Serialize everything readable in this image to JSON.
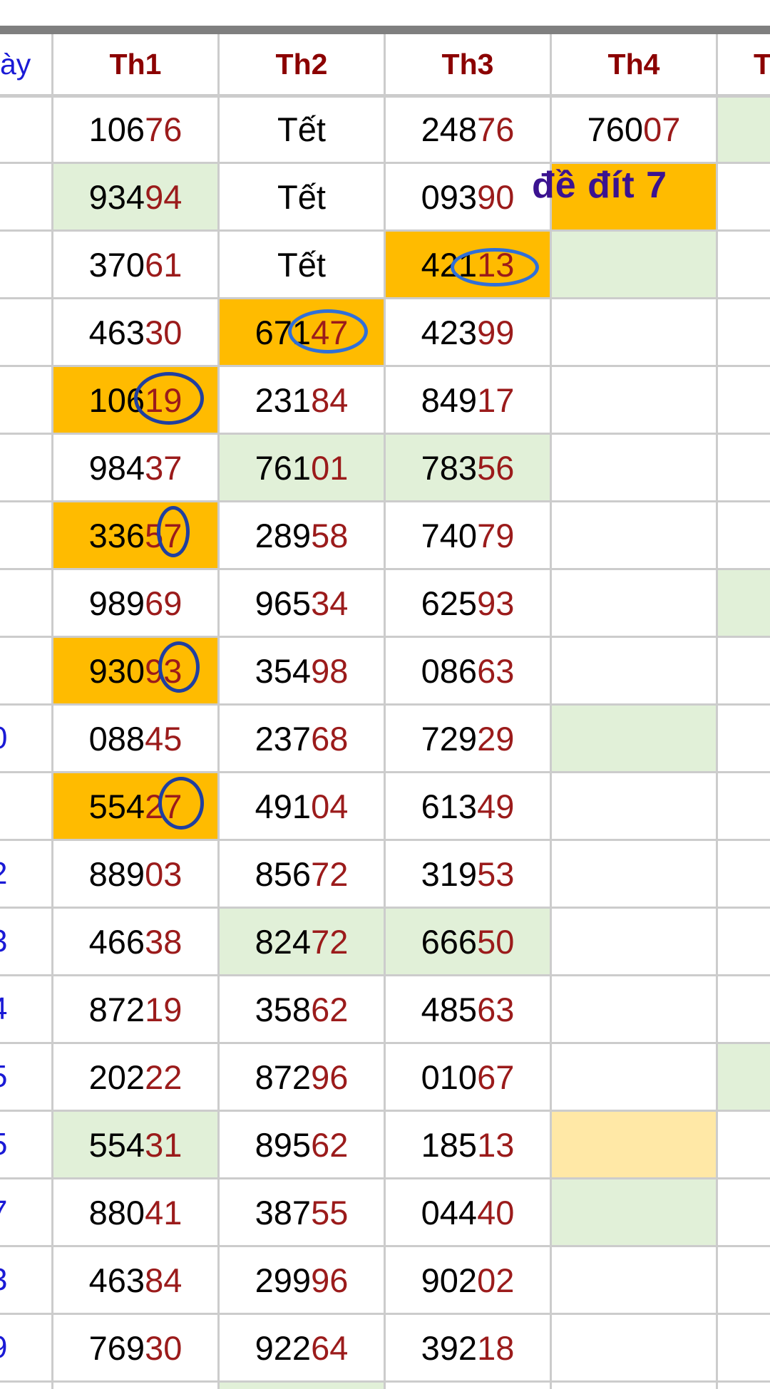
{
  "header": {
    "left_fragment": "ày",
    "columns": [
      "Th1",
      "Th2",
      "Th3",
      "Th4",
      "Th"
    ]
  },
  "row_labels": [
    "",
    "",
    "",
    "",
    "",
    "",
    "",
    "",
    "",
    "0",
    "",
    "2",
    "3",
    "4",
    "5",
    "5",
    "7",
    "3",
    "9"
  ],
  "rows": [
    [
      {
        "head": "106",
        "tail": "76"
      },
      {
        "head": "Tết",
        "tail": ""
      },
      {
        "head": "248",
        "tail": "76"
      },
      {
        "head": "760",
        "tail": "07"
      }
    ],
    [
      {
        "head": "934",
        "tail": "94"
      },
      {
        "head": "Tết",
        "tail": ""
      },
      {
        "head": "093",
        "tail": "90"
      },
      {
        "head": "",
        "tail": ""
      }
    ],
    [
      {
        "head": "370",
        "tail": "61"
      },
      {
        "head": "Tết",
        "tail": ""
      },
      {
        "head": "421",
        "tail": "13"
      },
      {
        "head": "",
        "tail": ""
      }
    ],
    [
      {
        "head": "463",
        "tail": "30"
      },
      {
        "head": "671",
        "tail": "47"
      },
      {
        "head": "423",
        "tail": "99"
      },
      {
        "head": "",
        "tail": ""
      }
    ],
    [
      {
        "head": "106",
        "tail": "19"
      },
      {
        "head": "231",
        "tail": "84"
      },
      {
        "head": "849",
        "tail": "17"
      },
      {
        "head": "",
        "tail": ""
      }
    ],
    [
      {
        "head": "984",
        "tail": "37"
      },
      {
        "head": "761",
        "tail": "01"
      },
      {
        "head": "783",
        "tail": "56"
      },
      {
        "head": "",
        "tail": ""
      }
    ],
    [
      {
        "head": "336",
        "tail": "57"
      },
      {
        "head": "289",
        "tail": "58"
      },
      {
        "head": "740",
        "tail": "79"
      },
      {
        "head": "",
        "tail": ""
      }
    ],
    [
      {
        "head": "989",
        "tail": "69"
      },
      {
        "head": "965",
        "tail": "34"
      },
      {
        "head": "625",
        "tail": "93"
      },
      {
        "head": "",
        "tail": ""
      }
    ],
    [
      {
        "head": "930",
        "tail": "93"
      },
      {
        "head": "354",
        "tail": "98"
      },
      {
        "head": "086",
        "tail": "63"
      },
      {
        "head": "",
        "tail": ""
      }
    ],
    [
      {
        "head": "088",
        "tail": "45"
      },
      {
        "head": "237",
        "tail": "68"
      },
      {
        "head": "729",
        "tail": "29"
      },
      {
        "head": "",
        "tail": ""
      }
    ],
    [
      {
        "head": "554",
        "tail": "27"
      },
      {
        "head": "491",
        "tail": "04"
      },
      {
        "head": "613",
        "tail": "49"
      },
      {
        "head": "",
        "tail": ""
      }
    ],
    [
      {
        "head": "889",
        "tail": "03"
      },
      {
        "head": "856",
        "tail": "72"
      },
      {
        "head": "319",
        "tail": "53"
      },
      {
        "head": "",
        "tail": ""
      }
    ],
    [
      {
        "head": "466",
        "tail": "38"
      },
      {
        "head": "824",
        "tail": "72"
      },
      {
        "head": "666",
        "tail": "50"
      },
      {
        "head": "",
        "tail": ""
      }
    ],
    [
      {
        "head": "872",
        "tail": "19"
      },
      {
        "head": "358",
        "tail": "62"
      },
      {
        "head": "485",
        "tail": "63"
      },
      {
        "head": "",
        "tail": ""
      }
    ],
    [
      {
        "head": "202",
        "tail": "22"
      },
      {
        "head": "872",
        "tail": "96"
      },
      {
        "head": "010",
        "tail": "67"
      },
      {
        "head": "",
        "tail": ""
      }
    ],
    [
      {
        "head": "554",
        "tail": "31"
      },
      {
        "head": "895",
        "tail": "62"
      },
      {
        "head": "185",
        "tail": "13"
      },
      {
        "head": "",
        "tail": ""
      }
    ],
    [
      {
        "head": "880",
        "tail": "41"
      },
      {
        "head": "387",
        "tail": "55"
      },
      {
        "head": "044",
        "tail": "40"
      },
      {
        "head": "",
        "tail": ""
      }
    ],
    [
      {
        "head": "463",
        "tail": "84"
      },
      {
        "head": "299",
        "tail": "96"
      },
      {
        "head": "902",
        "tail": "02"
      },
      {
        "head": "",
        "tail": ""
      }
    ],
    [
      {
        "head": "769",
        "tail": "30"
      },
      {
        "head": "922",
        "tail": "64"
      },
      {
        "head": "392",
        "tail": "18"
      },
      {
        "head": "",
        "tail": ""
      }
    ]
  ],
  "annotation": "đề đít 7",
  "colors": {
    "highlight_orange": "#ffbb00",
    "highlight_green": "#e1f0d8",
    "highlight_yellow": "#ffe8a6",
    "header_text": "#8b0000",
    "tail_digits": "#9b1b1b",
    "row_label": "#1a1ad6",
    "annotation_text": "#3b1390",
    "circle_marks": "#1f3fa0"
  }
}
